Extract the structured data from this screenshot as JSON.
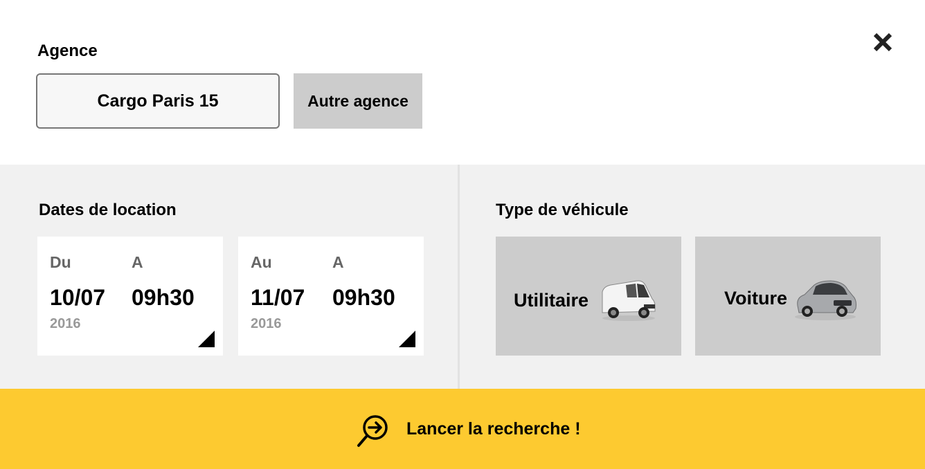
{
  "agence": {
    "title": "Agence",
    "selected": "Cargo Paris 15",
    "other_button": "Autre agence",
    "close_icon": "close-icon"
  },
  "dates": {
    "title": "Dates de location",
    "from": {
      "date_label": "Du",
      "time_label": "A",
      "date": "10/07",
      "time": "09h30",
      "year": "2016"
    },
    "to": {
      "date_label": "Au",
      "time_label": "A",
      "date": "11/07",
      "time": "09h30",
      "year": "2016"
    }
  },
  "vehicle": {
    "title": "Type de véhicule",
    "options": [
      {
        "label": "Utilitaire",
        "icon": "van-icon"
      },
      {
        "label": "Voiture",
        "icon": "car-icon"
      }
    ]
  },
  "search": {
    "label": "Lancer la recherche !",
    "icon": "search-arrow-icon"
  },
  "colors": {
    "accent": "#fdca30",
    "panel_bg": "#f1f1f1",
    "card_grey": "#cccccc"
  }
}
